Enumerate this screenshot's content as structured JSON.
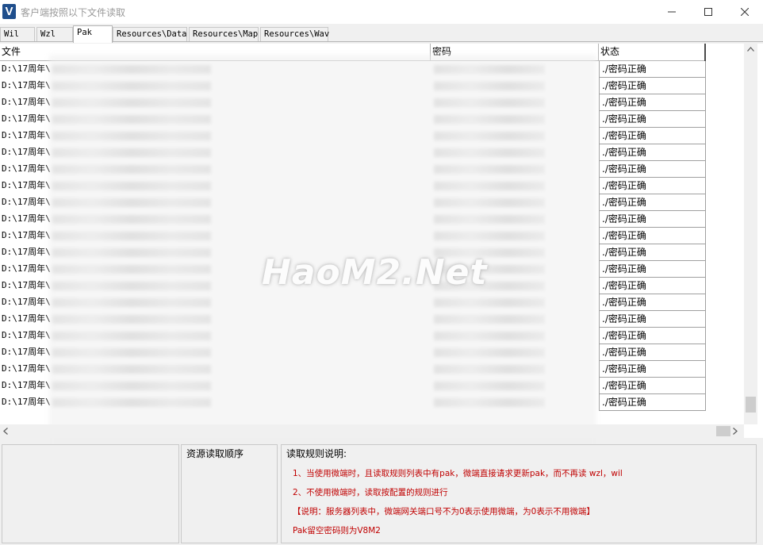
{
  "window": {
    "title": "客户端按照以下文件读取",
    "icon_letter": "V",
    "icon_name": "app-v-icon"
  },
  "tabs": [
    {
      "label": "Wil",
      "active": false
    },
    {
      "label": "Wzl",
      "active": false
    },
    {
      "label": "Pak",
      "active": true
    },
    {
      "label": "Resources\\Data",
      "active": false
    },
    {
      "label": "Resources\\Map",
      "active": false
    },
    {
      "label": "Resources\\Wav",
      "active": false
    }
  ],
  "table": {
    "columns": [
      "文件",
      "密码",
      "状态"
    ],
    "rows": [
      {
        "file": "D:\\17周年\\",
        "status": "./密码正确"
      },
      {
        "file": "D:\\17周年\\",
        "status": "./密码正确"
      },
      {
        "file": "D:\\17周年\\",
        "status": "./密码正确"
      },
      {
        "file": "D:\\17周年\\",
        "status": "./密码正确"
      },
      {
        "file": "D:\\17周年\\",
        "status": "./密码正确"
      },
      {
        "file": "D:\\17周年\\",
        "status": "./密码正确"
      },
      {
        "file": "D:\\17周年\\",
        "status": "./密码正确"
      },
      {
        "file": "D:\\17周年\\",
        "status": "./密码正确"
      },
      {
        "file": "D:\\17周年\\",
        "status": "./密码正确"
      },
      {
        "file": "D:\\17周年\\",
        "status": "./密码正确"
      },
      {
        "file": "D:\\17周年\\",
        "status": "./密码正确"
      },
      {
        "file": "D:\\17周年\\",
        "status": "./密码正确"
      },
      {
        "file": "D:\\17周年\\",
        "status": "./密码正确"
      },
      {
        "file": "D:\\17周年\\",
        "status": "./密码正确"
      },
      {
        "file": "D:\\17周年\\",
        "status": "./密码正确"
      },
      {
        "file": "D:\\17周年\\",
        "status": "./密码正确"
      },
      {
        "file": "D:\\17周年\\",
        "status": "./密码正确"
      },
      {
        "file": "D:\\17周年\\",
        "status": "./密码正确"
      },
      {
        "file": "D:\\17周年\\",
        "status": "./密码正确"
      },
      {
        "file": "D:\\17周年\\",
        "status": "./密码正确"
      },
      {
        "file": "D:\\17周年\\",
        "status": "./密码正确"
      }
    ]
  },
  "watermark": "HaoM2.Net",
  "bottom": {
    "order_title": "资源读取顺序",
    "rules_title": "读取规则说明:",
    "rules": [
      "1、当使用微端时，且读取规则列表中有pak，微端直接请求更新pak，而不再读 wzl，wil",
      "2、不使用微端时，读取按配置的规则进行",
      "【说明：服务器列表中，微端网关端口号不为0表示使用微端，为0表示不用微端】",
      "Pak留空密码则为V8M2"
    ]
  },
  "colors": {
    "rule_text": "#c00000",
    "icon_bg": "#1f4e8c"
  }
}
